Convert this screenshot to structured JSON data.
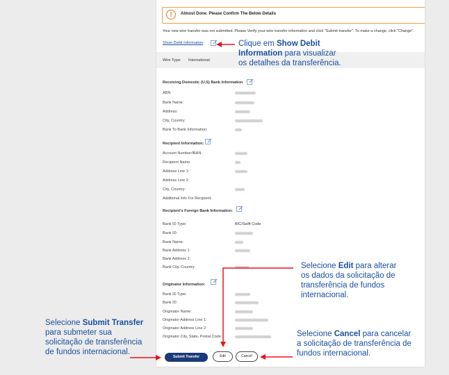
{
  "notice": {
    "text": "Almost Done. Please Confirm The Below Details",
    "icon": "exclamation-icon"
  },
  "message": "Your new wire transfer was not submitted. Please Verify your wire transfer information and click \"Submit transfer\". To make a change, click \"Change\".",
  "show_debit_link": "Show Debit Information",
  "wire_type": {
    "label": "Wire Type:",
    "value": "International"
  },
  "sections": {
    "receiving": {
      "title": "Receiving Domestic (U.S) Bank Information",
      "fields": [
        "ABA:",
        "Bank Name:",
        "Address:",
        "City, Country:",
        "Bank To Bank Information:"
      ]
    },
    "recipient": {
      "title": "Recipient Information:",
      "fields": [
        "Account Number/IBAN:",
        "Recipient Name:",
        "Address Line 1:",
        "Address Line 2:",
        "City, Country:",
        "Additional Info For Recipient:"
      ]
    },
    "foreign": {
      "title": "Recipient's Foreign Bank Information:",
      "fields": [
        "Bank ID Type:",
        "Bank ID:",
        "Bank Name:",
        "Bank Address 1:",
        "Bank Address 2:",
        "Bank City, Country:"
      ],
      "bank_id_type_value": "BIC/Swift Code"
    },
    "originator": {
      "title": "Originator Information:",
      "fields": [
        "Bank ID Type:",
        "Bank ID:",
        "Originator Name:",
        "Originator Address Line 1:",
        "Originator Address Line 2:",
        "Originator City, State, Postal Code:"
      ]
    }
  },
  "buttons": {
    "submit": "Submit Transfer",
    "edit": "Edit",
    "cancel": "Cancel"
  },
  "callouts": {
    "show_debit": {
      "l1a": "Clique em ",
      "l1b": "Show Debit",
      "l2a": "Information",
      "l2b": " para visualizar",
      "l3": "os detalhes da transferência."
    },
    "edit": {
      "l1a": "Selecione ",
      "l1b": "Edit",
      "l1c": " para alterar",
      "l2": "os dados da solicitação de",
      "l3": "transferência de fundos",
      "l4": "internacional."
    },
    "submit": {
      "l1a": "Selecione ",
      "l1b": "Submit Transfer",
      "l2": "para submeter sua",
      "l3": "solicitação de transferência",
      "l4": "de fundos internacional."
    },
    "cancel": {
      "l1a": "Selecione ",
      "l1b": "Cancel",
      "l1c": " para cancelar",
      "l2": "a solicitação de transferência de",
      "l3": "fundos internacional."
    }
  },
  "colors": {
    "accent": "#1b3a78",
    "callout": "#1a4fa0",
    "arrow": "#e8141c",
    "warning": "#e9a04a"
  }
}
